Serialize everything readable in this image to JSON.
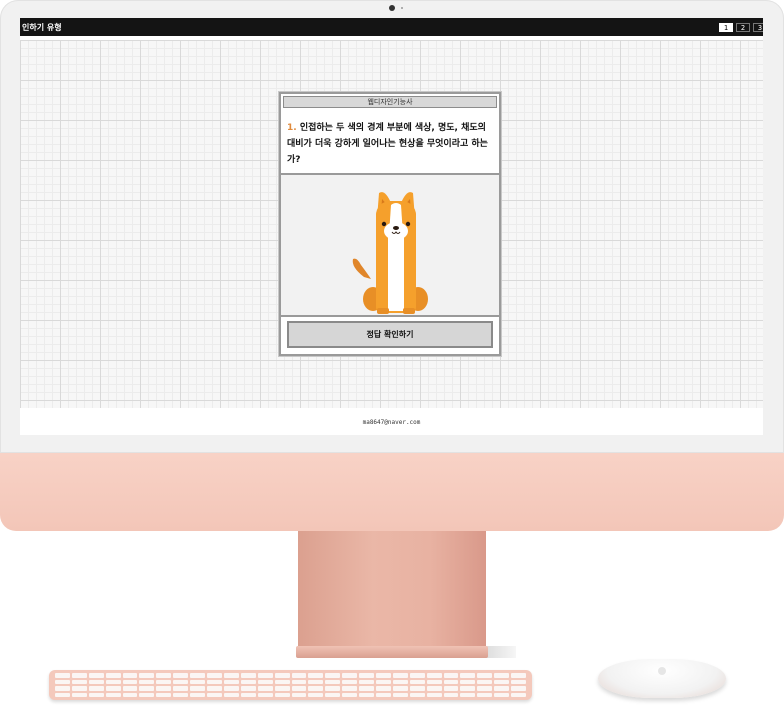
{
  "app": {
    "title": "인하기 유형",
    "page_tabs": [
      "1",
      "2",
      "3"
    ],
    "active_page": "1"
  },
  "quiz": {
    "header": "웹디자인기능사",
    "question_number": "1.",
    "question_text": "인접하는 두 색의 경계 부분에 색상, 명도, 채도의 대비가 더욱 강하게 일어나는 현상을 무엇이라고 하는가?",
    "image_icon": "dog-illustration",
    "confirm_label": "정답 확인하기"
  },
  "footer": {
    "email": "ma8647@naver.com"
  },
  "colors": {
    "topbar": "#141414",
    "question_number": "#e08a3c",
    "dog": "#f5a02c",
    "imac_body": "#f3c6b8"
  }
}
